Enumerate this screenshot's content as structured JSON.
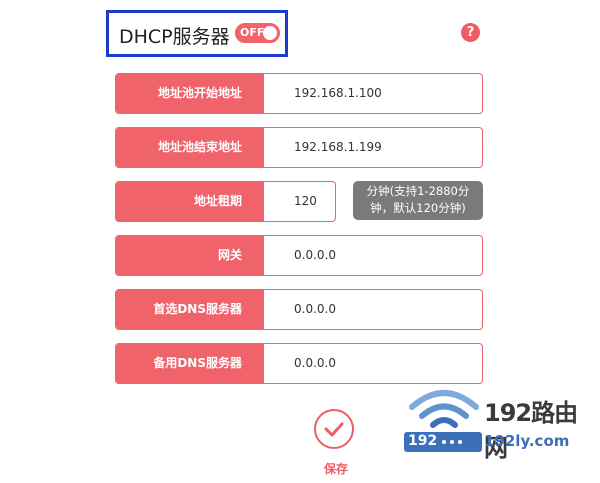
{
  "header": {
    "title": "DHCP服务器",
    "toggle_label": "OFF",
    "help_symbol": "?"
  },
  "fields": [
    {
      "label": "地址池开始地址",
      "value": "192.168.1.100"
    },
    {
      "label": "地址池结束地址",
      "value": "192.168.1.199"
    },
    {
      "label": "地址租期",
      "value": "120"
    },
    {
      "label": "网关",
      "value": "0.0.0.0"
    },
    {
      "label": "首选DNS服务器",
      "value": "0.0.0.0"
    },
    {
      "label": "备用DNS服务器",
      "value": "0.0.0.0"
    }
  ],
  "lease_hint": {
    "line1": "分钟(支持1-2880分",
    "line2": "钟，默认120分钟)"
  },
  "save": {
    "label": "保存"
  },
  "watermark": {
    "title": "192路由网",
    "url": "192ly.com",
    "badge": "192"
  },
  "colors": {
    "accent": "#f0636a",
    "highlight_border": "#1a3cc8",
    "tooltip_bg": "#7a7a7a",
    "watermark_blue": "#3b6fb8"
  },
  "icons": {
    "help": "help-icon",
    "save": "checkmark-icon",
    "watermark": "wifi-icon"
  }
}
